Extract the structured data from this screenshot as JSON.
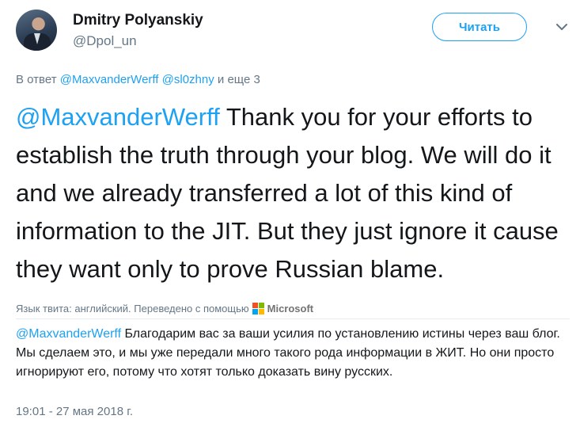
{
  "author": {
    "name": "Dmitry Polyanskiy",
    "handle": "@Dpol_un"
  },
  "follow_button": {
    "label": "Читать"
  },
  "menu": {
    "icon": "chevron-down-icon"
  },
  "reply_context": {
    "prefix": "В ответ",
    "mention1": "@MaxvanderWerff",
    "mention2": "@sl0zhny",
    "suffix": "и еще 3"
  },
  "tweet": {
    "mention": "@MaxvanderWerff",
    "text": "Thank you for your efforts to establish the truth through your blog. We will do it and we already transferred a lot of this kind of information to the JIT. But they just ignore it cause they want only to prove Russian blame."
  },
  "translation_meta": {
    "label": "Язык твита: английский. Переведено с помощью",
    "provider": "Microsoft",
    "colors": [
      "#f25022",
      "#7fba00",
      "#00a4ef",
      "#ffb900"
    ]
  },
  "translation": {
    "mention": "@MaxvanderWerff",
    "text": "Благодарим вас за ваши усилия по установлению истины через ваш блог. Мы сделаем это, и мы уже передали много такого рода информации в ЖИТ. Но они просто игнорируют его, потому что хотят только доказать вину русских."
  },
  "timestamp": "19:01 - 27 мая 2018 г.",
  "colors": {
    "link": "#1da1f2",
    "secondary": "#657786",
    "text": "#14171a"
  }
}
